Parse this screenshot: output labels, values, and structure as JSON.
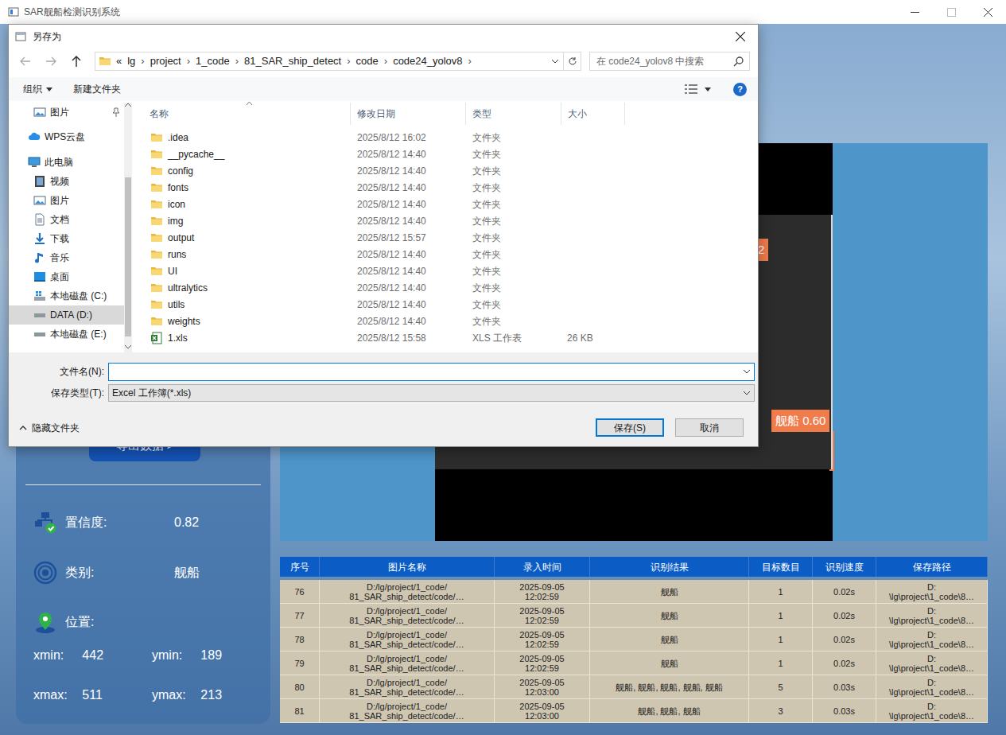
{
  "window": {
    "title": "SAR舰船检测识别系统"
  },
  "sidebar": {
    "export_button": "导出数据 >",
    "confidence": {
      "label": "置信度:",
      "value": "0.82"
    },
    "category": {
      "label": "类别:",
      "value": "舰船"
    },
    "position": {
      "label": "位置:"
    },
    "coords": [
      [
        {
          "label": "xmin:",
          "value": "442"
        },
        {
          "label": "ymin:",
          "value": "189"
        }
      ],
      [
        {
          "label": "xmax:",
          "value": "511"
        },
        {
          "label": "ymax:",
          "value": "213"
        }
      ]
    ]
  },
  "image": {
    "labels": [
      "2",
      "舰船 0.60"
    ]
  },
  "table": {
    "columns": [
      "序号",
      "图片名称",
      "录入时间",
      "识别结果",
      "目标数目",
      "识别速度",
      "保存路径"
    ],
    "rows": [
      [
        "76",
        "D:/lg/project/1_code/\n81_SAR_ship_detect/code/…",
        "2025-09-05\n12:02:59",
        "舰船",
        "1",
        "0.02s",
        "D:\n\\lg\\project\\1_code\\8…"
      ],
      [
        "77",
        "D:/lg/project/1_code/\n81_SAR_ship_detect/code/…",
        "2025-09-05\n12:02:59",
        "舰船",
        "1",
        "0.02s",
        "D:\n\\lg\\project\\1_code\\8…"
      ],
      [
        "78",
        "D:/lg/project/1_code/\n81_SAR_ship_detect/code/…",
        "2025-09-05\n12:02:59",
        "舰船",
        "1",
        "0.02s",
        "D:\n\\lg\\project\\1_code\\8…"
      ],
      [
        "79",
        "D:/lg/project/1_code/\n81_SAR_ship_detect/code/…",
        "2025-09-05\n12:02:59",
        "舰船",
        "1",
        "0.02s",
        "D:\n\\lg\\project\\1_code\\8…"
      ],
      [
        "80",
        "D:/lg/project/1_code/\n81_SAR_ship_detect/code/…",
        "2025-09-05\n12:03:00",
        "舰船, 舰船, 舰船, 舰船, 舰船",
        "5",
        "0.03s",
        "D:\n\\lg\\project\\1_code\\8…"
      ],
      [
        "81",
        "D:/lg/project/1_code/\n81_SAR_ship_detect/code/…",
        "2025-09-05\n12:03:00",
        "舰船, 舰船, 舰船",
        "3",
        "0.03s",
        "D:\n\\lg\\project\\1_code\\8…"
      ]
    ]
  },
  "dialog": {
    "title": "另存为",
    "breadcrumb": {
      "prefix": "«",
      "segments": [
        "lg",
        "project",
        "1_code",
        "81_SAR_ship_detect",
        "code",
        "code24_yolov8"
      ],
      "separator": "›"
    },
    "search": {
      "placeholder": "在 code24_yolov8 中搜索"
    },
    "toolbar": {
      "organize": "组织",
      "new_folder": "新建文件夹",
      "help": "?"
    },
    "tree": [
      [
        {
          "label": "图片",
          "kind": "pictures",
          "depth": 1,
          "pinned": true,
          "selected": false
        }
      ],
      [
        {
          "label": "WPS云盘",
          "kind": "cloud",
          "depth": 0,
          "pinned": false,
          "selected": false
        }
      ],
      [
        {
          "label": "此电脑",
          "kind": "pc",
          "depth": 0,
          "pinned": false,
          "selected": false
        },
        {
          "label": "视频",
          "kind": "video",
          "depth": 1,
          "pinned": false,
          "selected": false
        },
        {
          "label": "图片",
          "kind": "pictures",
          "depth": 1,
          "pinned": false,
          "selected": false
        },
        {
          "label": "文档",
          "kind": "docs",
          "depth": 1,
          "pinned": false,
          "selected": false
        },
        {
          "label": "下载",
          "kind": "download",
          "depth": 1,
          "pinned": false,
          "selected": false
        },
        {
          "label": "音乐",
          "kind": "music",
          "depth": 1,
          "pinned": false,
          "selected": false
        },
        {
          "label": "桌面",
          "kind": "desktop",
          "depth": 1,
          "pinned": false,
          "selected": false
        },
        {
          "label": "本地磁盘 (C:)",
          "kind": "sysdrive",
          "depth": 1,
          "pinned": false,
          "selected": false
        },
        {
          "label": "DATA (D:)",
          "kind": "drive",
          "depth": 1,
          "pinned": false,
          "selected": true
        },
        {
          "label": "本地磁盘 (E:)",
          "kind": "drive",
          "depth": 1,
          "pinned": false,
          "selected": false
        }
      ]
    ],
    "columns": [
      "名称",
      "修改日期",
      "类型",
      "大小"
    ],
    "files": [
      {
        "name": ".idea",
        "date": "2025/8/12 16:02",
        "type": "文件夹",
        "kind": "folder"
      },
      {
        "name": "__pycache__",
        "date": "2025/8/12 14:40",
        "type": "文件夹",
        "kind": "folder"
      },
      {
        "name": "config",
        "date": "2025/8/12 14:40",
        "type": "文件夹",
        "kind": "folder"
      },
      {
        "name": "fonts",
        "date": "2025/8/12 14:40",
        "type": "文件夹",
        "kind": "folder"
      },
      {
        "name": "icon",
        "date": "2025/8/12 14:40",
        "type": "文件夹",
        "kind": "folder"
      },
      {
        "name": "img",
        "date": "2025/8/12 14:40",
        "type": "文件夹",
        "kind": "folder"
      },
      {
        "name": "output",
        "date": "2025/8/12 15:57",
        "type": "文件夹",
        "kind": "folder"
      },
      {
        "name": "runs",
        "date": "2025/8/12 14:40",
        "type": "文件夹",
        "kind": "folder"
      },
      {
        "name": "UI",
        "date": "2025/8/12 14:40",
        "type": "文件夹",
        "kind": "folder"
      },
      {
        "name": "ultralytics",
        "date": "2025/8/12 14:40",
        "type": "文件夹",
        "kind": "folder"
      },
      {
        "name": "utils",
        "date": "2025/8/12 14:40",
        "type": "文件夹",
        "kind": "folder"
      },
      {
        "name": "weights",
        "date": "2025/8/12 14:40",
        "type": "文件夹",
        "kind": "folder"
      },
      {
        "name": "1.xls",
        "date": "2025/8/12 15:58",
        "type": "XLS 工作表",
        "size": "26 KB",
        "kind": "xls"
      }
    ],
    "filename": {
      "label": "文件名(N):",
      "value": ""
    },
    "filetype": {
      "label": "保存类型(T):",
      "value": "Excel 工作簿(*.xls)"
    },
    "hide_folders": "隐藏文件夹",
    "buttons": [
      {
        "label": "保存(S)",
        "default": true
      },
      {
        "label": "取消",
        "default": false
      }
    ]
  }
}
